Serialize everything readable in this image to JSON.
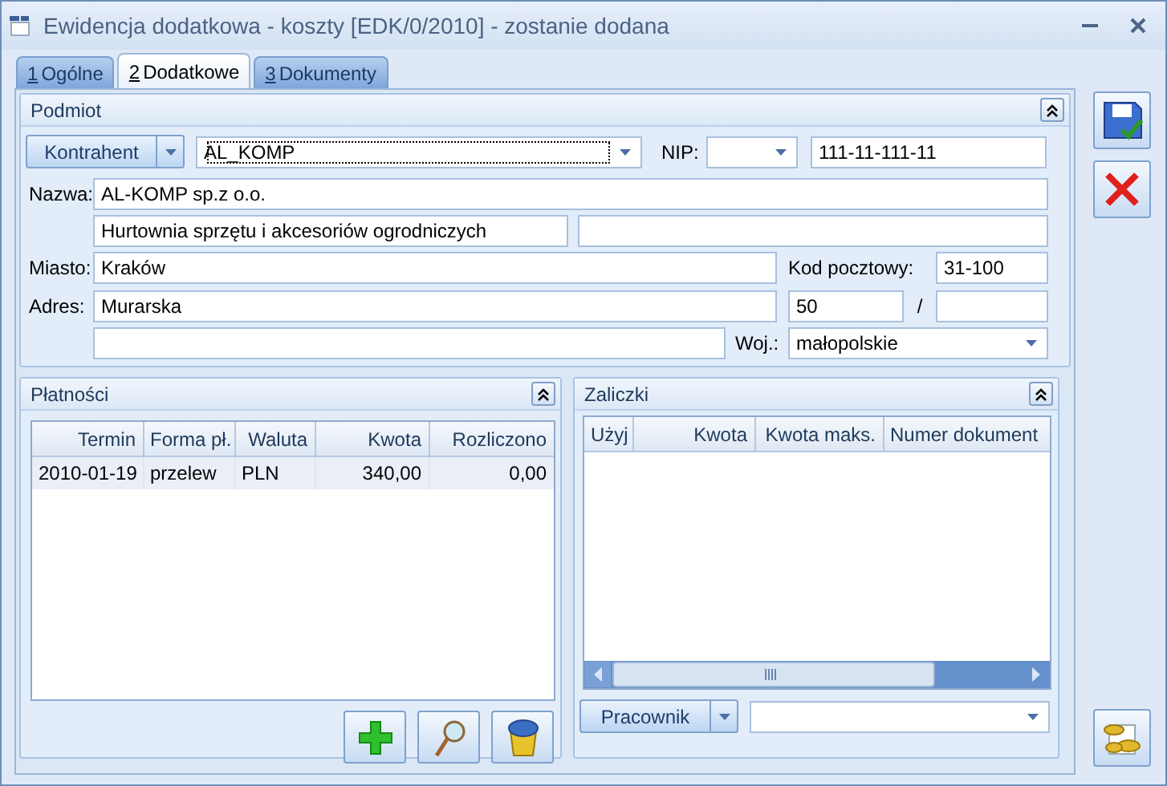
{
  "window": {
    "title": "Ewidencja dodatkowa - koszty [EDK/0/2010] - zostanie dodana"
  },
  "tabs": [
    {
      "key": "1",
      "label": "Ogólne",
      "selected": false
    },
    {
      "key": "2",
      "label": "Dodatkowe",
      "selected": true
    },
    {
      "key": "3",
      "label": "Dokumenty",
      "selected": false
    }
  ],
  "podmiot": {
    "title": "Podmiot",
    "type_button": "Kontrahent",
    "code": "AL_KOMP",
    "nip_label": "NIP:",
    "nip": "111-11-111-11",
    "name_label": "Nazwa:",
    "name": "AL-KOMP sp.z o.o.",
    "name_2": "Hurtownia sprzętu i akcesoriów ogrodniczych",
    "city_label": "Miasto:",
    "city": "Kraków",
    "postal_label": "Kod pocztowy:",
    "postal": "31-100",
    "address_label": "Adres:",
    "street": "Murarska",
    "house_number": "50",
    "separator": "/",
    "region_label": "Woj.:",
    "region": "małopolskie"
  },
  "payments": {
    "title": "Płatności",
    "columns": [
      "Termin",
      "Forma pł.",
      "Waluta",
      "Kwota",
      "Rozliczono"
    ],
    "rows": [
      {
        "selected": true,
        "cells": [
          "2010-01-19",
          "przelew",
          "PLN",
          "340,00",
          "0,00"
        ]
      }
    ]
  },
  "advances": {
    "title": "Zaliczki",
    "columns": [
      "Użyj",
      "Kwota",
      "Kwota maks.",
      "Numer dokument"
    ],
    "type_button": "Pracownik"
  }
}
